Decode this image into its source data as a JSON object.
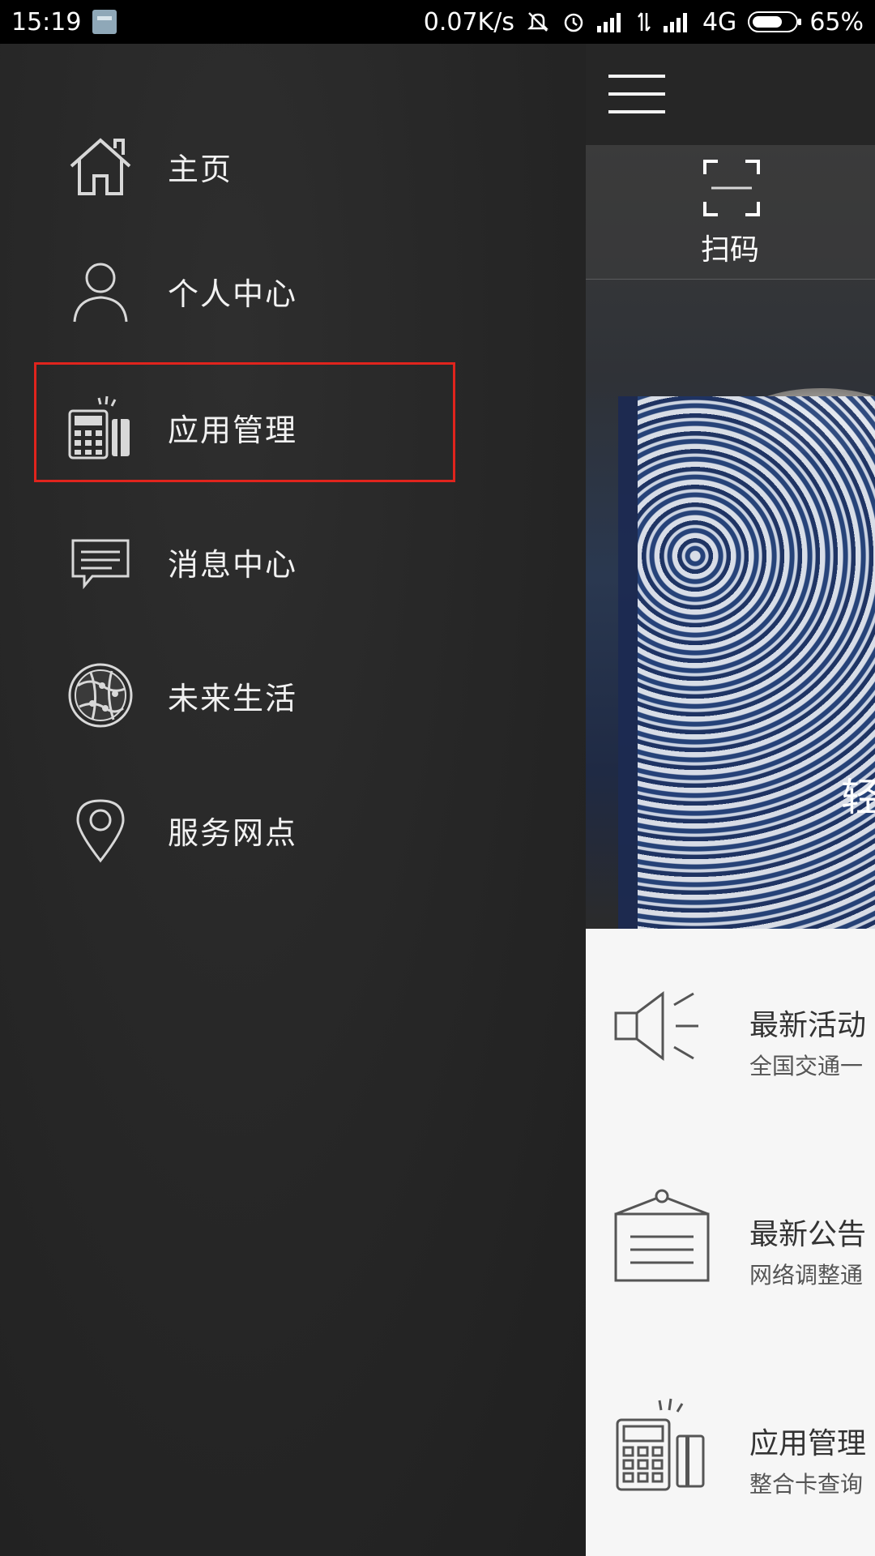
{
  "status_bar": {
    "time": "15:19",
    "speed": "0.07K/s",
    "network": "4G",
    "battery": "65%"
  },
  "drawer": {
    "items": [
      {
        "label": "主页",
        "icon": "home-icon"
      },
      {
        "label": "个人中心",
        "icon": "person-icon"
      },
      {
        "label": "应用管理",
        "icon": "calculator-card-icon",
        "highlighted": true
      },
      {
        "label": "消息中心",
        "icon": "message-icon"
      },
      {
        "label": "未来生活",
        "icon": "globe-network-icon"
      },
      {
        "label": "服务网点",
        "icon": "location-pin-icon"
      }
    ],
    "highlight_color": "#e0241d"
  },
  "main": {
    "scan_label": "扫码",
    "banner_text": "轻",
    "cards": [
      {
        "title": "最新活动",
        "subtitle": "全国交通一",
        "icon": "megaphone-icon"
      },
      {
        "title": "最新公告",
        "subtitle": "网络调整通",
        "icon": "notice-board-icon"
      },
      {
        "title": "应用管理",
        "subtitle": "整合卡查询",
        "icon": "calculator-card-icon"
      }
    ]
  }
}
